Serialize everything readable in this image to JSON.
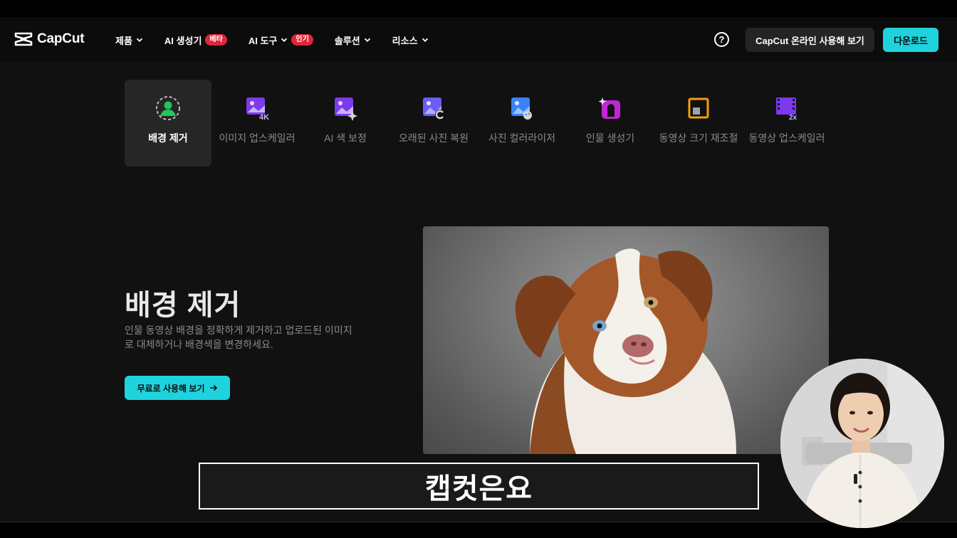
{
  "header": {
    "logo_text": "CapCut",
    "nav": [
      {
        "label": "제품",
        "badge": ""
      },
      {
        "label": "AI 생성기",
        "badge": "베타"
      },
      {
        "label": "AI 도구",
        "badge": "인기"
      },
      {
        "label": "솔루션",
        "badge": ""
      },
      {
        "label": "리소스",
        "badge": ""
      }
    ],
    "help_symbol": "?",
    "online_button": "CapCut 온라인 사용해 보기",
    "download_button": "다운로드"
  },
  "tools": [
    {
      "label": "배경 제거",
      "icon": "person-cutout-icon",
      "active": true
    },
    {
      "label": "이미지 업스케일러",
      "icon": "image-4k-icon",
      "active": false
    },
    {
      "label": "AI 색 보정",
      "icon": "image-sparkle-icon",
      "active": false
    },
    {
      "label": "오래된 사진 복원",
      "icon": "image-restore-icon",
      "active": false
    },
    {
      "label": "사진 컬러라이저",
      "icon": "image-palette-icon",
      "active": false
    },
    {
      "label": "인물 생성기",
      "icon": "portrait-generator-icon",
      "active": false
    },
    {
      "label": "동영상 크기 재조절",
      "icon": "resize-icon",
      "active": false
    },
    {
      "label": "동영상 업스케일러",
      "icon": "film-2x-icon",
      "active": false
    }
  ],
  "hero": {
    "title": "배경 제거",
    "description": "인물 동영상 배경을 정확하게 제거하고 업로드된 이미지로 대체하거나 배경색을 변경하세요.",
    "cta": "무료로 사용해 보기"
  },
  "subtitle": "캡컷은요",
  "colors": {
    "accent": "#1fd3dd",
    "badge_red": "#e0263b",
    "background": "#111111",
    "navbar": "#0c0c0c"
  }
}
